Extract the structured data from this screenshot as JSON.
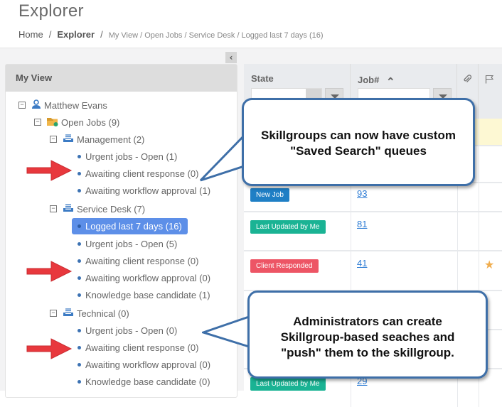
{
  "header": {
    "title": "Explorer",
    "breadcrumb": {
      "home": "Home",
      "current": "Explorer",
      "trail": "My View / Open Jobs / Service Desk / Logged last 7 days (16)",
      "separator": "/"
    }
  },
  "sidebar": {
    "collapse_icon": "chevron-left-icon",
    "collapse_glyph": "‹",
    "title": "My View",
    "tree": {
      "user": "Matthew Evans",
      "folder": "Open Jobs (9)",
      "groups": [
        {
          "label": "Management (2)",
          "items": [
            "Urgent jobs - Open (1)",
            "Awaiting client response (0)",
            "Awaiting workflow approval (1)"
          ]
        },
        {
          "label": "Service Desk (7)",
          "items": [
            "Logged last 7 days (16)",
            "Urgent jobs - Open (5)",
            "Awaiting client response (0)",
            "Awaiting workflow approval (0)",
            "Knowledge base candidate (1)"
          ],
          "selected_index": 0
        },
        {
          "label": "Technical (0)",
          "items": [
            "Urgent jobs - Open (0)",
            "Awaiting client response (0)",
            "Awaiting workflow approval (0)",
            "Knowledge base candidate (0)"
          ]
        }
      ]
    }
  },
  "grid": {
    "columns": {
      "state": "State",
      "job": "Job#",
      "sort_glyph": "⌃",
      "attachment_icon": "paperclip-icon",
      "flag_icon": "flag-icon"
    },
    "rows": [
      {
        "state": "New Job",
        "state_color": "#1f7fc5",
        "job": "93",
        "starred": false
      },
      {
        "state": "Last Updated by Me",
        "state_color": "#1ab394",
        "job": "81",
        "starred": false
      },
      {
        "state": "Client Responded",
        "state_color": "#ed5565",
        "job": "41",
        "starred": true
      },
      {
        "state": "Last Updated by Me",
        "state_color": "#1ab394",
        "job": "29",
        "starred": false
      }
    ],
    "highlight_row_color": "#fdf8d3",
    "star_glyph": "★"
  },
  "callouts": [
    {
      "text_line1": "Skillgroups can now have custom",
      "text_line2": "\"Saved Search\" queues"
    },
    {
      "text_line1": "Administrators can create",
      "text_line2": "Skillgroup-based seaches and",
      "text_line3": "\"push\" them to the skillgroup."
    }
  ],
  "colors": {
    "accent": "#5d8fe8",
    "callout_border": "#3e6fa8",
    "arrow": "#e8383d"
  }
}
